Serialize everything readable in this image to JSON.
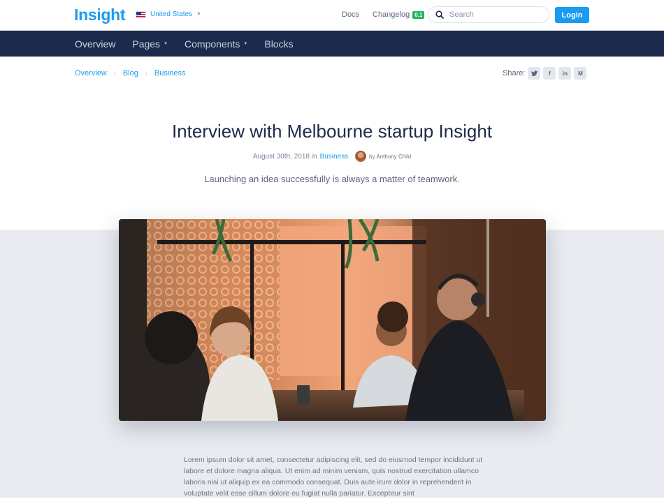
{
  "header": {
    "logo": "Insight",
    "country": "United States",
    "links": {
      "docs": "Docs",
      "changelog": "Changelog",
      "changelog_badge": "0.1"
    },
    "search_placeholder": "Search",
    "login_label": "Login"
  },
  "nav": {
    "items": [
      {
        "label": "Overview"
      },
      {
        "label": "Pages"
      },
      {
        "label": "Components"
      },
      {
        "label": "Blocks"
      }
    ]
  },
  "breadcrumb": [
    "Overview",
    "Blog",
    "Business"
  ],
  "share": {
    "label": "Share:",
    "buttons": [
      "twitter-icon",
      "facebook-icon",
      "linkedin-icon",
      "medium-icon"
    ]
  },
  "article": {
    "title": "Interview with Melbourne startup Insight",
    "date": "August 30th, 2018 in",
    "category": "Business",
    "author": "by Anthony Child",
    "subtitle": "Launching an idea successfully is always a matter of teamwork.",
    "body": "Lorem ipsum dolor sit amet, consectetur adipiscing elit, sed do eiusmod tempor incididunt ut labore et dolore magna aliqua. Ut enim ad minim veniam, quis nostrud exercitation ullamco laboris nisi ut aliquip ex ea commodo consequat. Duis aute irure dolor in reprehenderit in voluptate velit esse cillum dolore eu fugiat nulla pariatur. Excepteur sint"
  },
  "colors": {
    "accent": "#1a9bf0",
    "navbar": "#1c2b4d",
    "badge": "#21b35b",
    "page_gray": "#e9ebf0"
  }
}
